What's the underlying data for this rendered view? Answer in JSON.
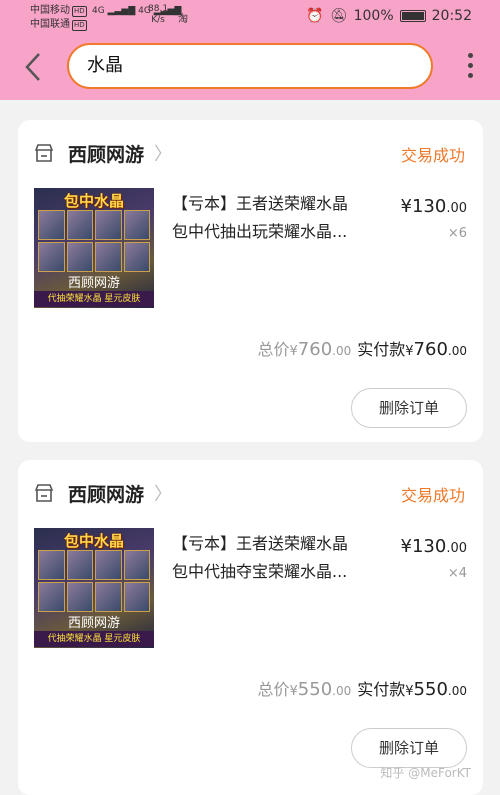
{
  "status_bar": {
    "carrier1": "中国移动",
    "carrier2": "中国联通",
    "hd": "HD",
    "signal": "4G",
    "speed": "88.1",
    "speed_unit": "K/s",
    "app_icon": "淘",
    "battery": "100%",
    "time": "20:52"
  },
  "search": {
    "query": "水晶"
  },
  "orders": [
    {
      "shop_name": "西顾网游",
      "status": "交易成功",
      "thumb_title": "包中水晶",
      "thumb_shop": "西顾网游",
      "thumb_sub": "代抽荣耀水晶 星元皮肤",
      "title_line1": "【亏本】王者送荣耀水晶",
      "title_line2": "包中代抽出玩荣耀水晶...",
      "unit_price_int": "130",
      "unit_price_dec": ".00",
      "qty": "×6",
      "total_label": "总价",
      "total_int": "760",
      "total_dec": ".00",
      "paid_label": "实付款",
      "paid_int": "760",
      "paid_dec": ".00",
      "delete_label": "删除订单"
    },
    {
      "shop_name": "西顾网游",
      "status": "交易成功",
      "thumb_title": "包中水晶",
      "thumb_shop": "西顾网游",
      "thumb_sub": "代抽荣耀水晶 星元皮肤",
      "title_line1": "【亏本】王者送荣耀水晶",
      "title_line2": "包中代抽夺宝荣耀水晶...",
      "unit_price_int": "130",
      "unit_price_dec": ".00",
      "qty": "×4",
      "total_label": "总价",
      "total_int": "550",
      "total_dec": ".00",
      "paid_label": "实付款",
      "paid_int": "550",
      "paid_dec": ".00",
      "delete_label": "删除订单"
    }
  ],
  "currency": "¥",
  "watermark": "知乎 @MeForKT",
  "colors": {
    "header_bg": "#f8a3c8",
    "accent": "#ee7a2c",
    "search_border": "#f07a2a"
  }
}
